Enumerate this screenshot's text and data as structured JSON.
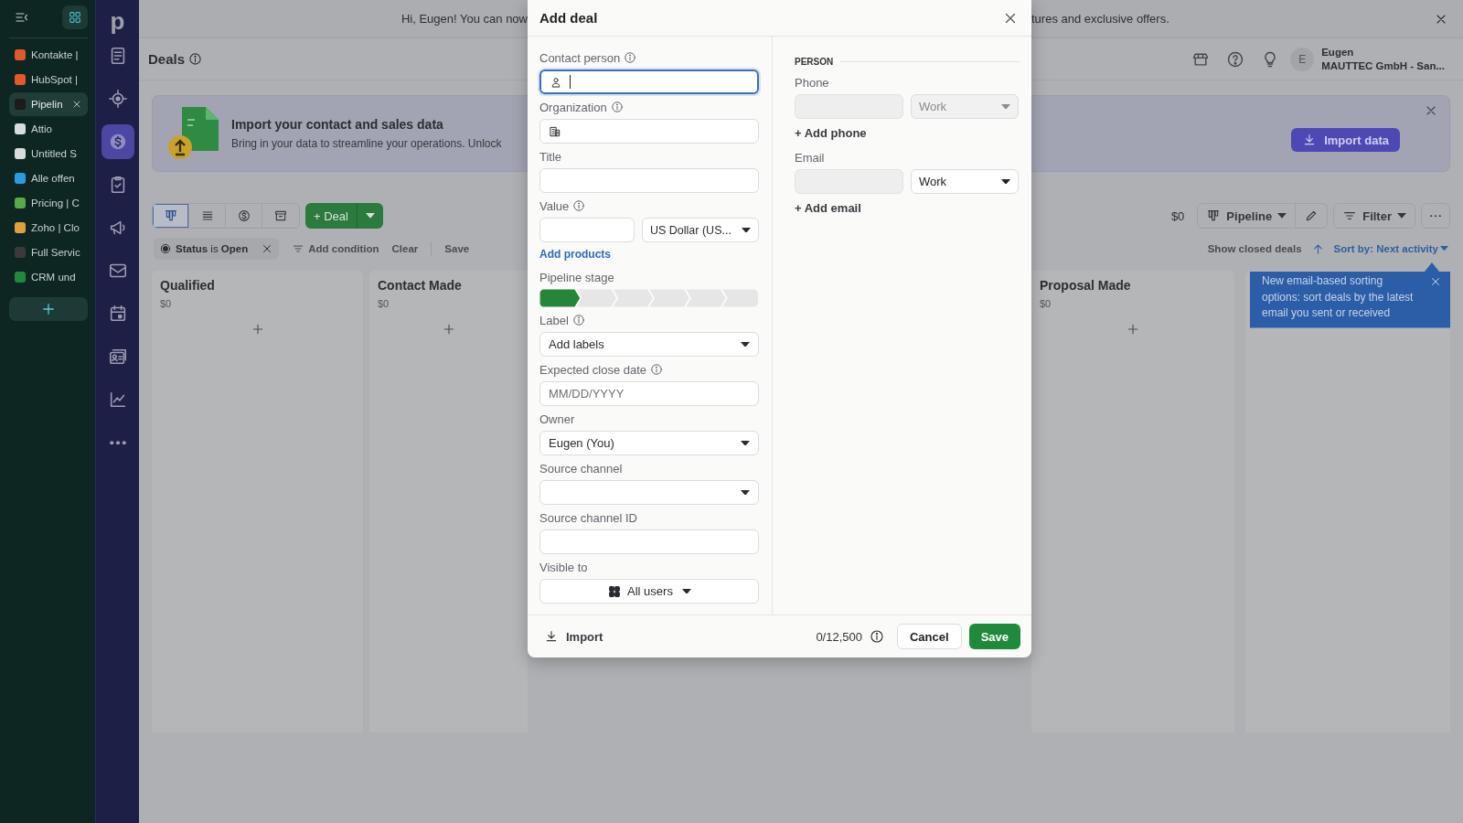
{
  "browser_sidebar": {
    "tabs": [
      {
        "label": "Kontakte |",
        "color": "#e0582c",
        "selected": false
      },
      {
        "label": "HubSpot |",
        "color": "#e8552a",
        "selected": false
      },
      {
        "label": "Pipelin",
        "color": "#1c1c1c",
        "selected": true
      },
      {
        "label": "Attio",
        "color": "#d8dcdc",
        "selected": false
      },
      {
        "label": "Untitled S",
        "color": "#d8dcdc",
        "selected": false
      },
      {
        "label": "Alle offen",
        "color": "#2a9be0",
        "selected": false
      },
      {
        "label": "Pricing | C",
        "color": "#5aa848",
        "selected": false
      },
      {
        "label": "Zoho | Clo",
        "color": "#e2a03a",
        "selected": false
      },
      {
        "label": "Full Servic",
        "color": "#3a3a3a",
        "selected": false
      },
      {
        "label": "CRM und",
        "color": "#1f8a3c",
        "selected": false
      }
    ]
  },
  "nav_rail": {
    "logo": "p",
    "items": [
      {
        "selected": false
      },
      {
        "selected": false
      },
      {
        "selected": true
      },
      {
        "selected": false
      },
      {
        "selected": false
      },
      {
        "selected": false
      },
      {
        "selected": false
      },
      {
        "selected": false
      },
      {
        "selected": false
      },
      {
        "selected": false
      }
    ]
  },
  "announcement": {
    "text_start": "Hi, Eugen! You can now",
    "text_end": "tures and exclusive offers."
  },
  "header": {
    "title": "Deals",
    "user": {
      "initial": "E",
      "name": "Eugen",
      "company": "MAUTTEC GmbH - San..."
    }
  },
  "import_banner": {
    "title": "Import your contact and sales data",
    "text": "Bring in your data to streamline your operations. Unlock",
    "button": "Import data"
  },
  "toolbar": {
    "views": [
      {
        "selected": true
      },
      {
        "selected": false
      },
      {
        "selected": false
      },
      {
        "selected": false
      }
    ],
    "add_button": "+ Deal",
    "total": "$0",
    "pipeline": "Pipeline",
    "filter": "Filter"
  },
  "filters": {
    "chip": "**Status** is **Open**",
    "add_condition": "Add condition",
    "clear": "Clear",
    "save": "Save",
    "show_closed": "Show closed deals",
    "sort": "Sort by: Next activity"
  },
  "columns": [
    {
      "title": "Qualified",
      "total": "$0"
    },
    {
      "title": "Contact Made",
      "total": "$0"
    },
    {
      "title": "Proposal Made",
      "total": "$0"
    }
  ],
  "tooltip": {
    "text": "New email-based sorting options: sort deals by the latest email you sent or received"
  },
  "modal": {
    "title": "Add deal",
    "fields": [
      {
        "kind": "contact",
        "label": "Contact person",
        "info": true,
        "focused": true
      },
      {
        "kind": "organization",
        "label": "Organization",
        "info": true,
        "focused": false
      },
      {
        "kind": "text",
        "label": "Title",
        "info": false,
        "focused": false
      },
      {
        "kind": "value",
        "label": "Value",
        "info": true,
        "focused": false,
        "currency": "US Dollar (US...",
        "link": "Add products"
      },
      {
        "kind": "stages",
        "label": "Pipeline stage",
        "info": false,
        "stages": [
          {
            "selected": true
          },
          {
            "selected": false
          },
          {
            "selected": false
          },
          {
            "selected": false
          },
          {
            "selected": false
          },
          {
            "selected": false
          }
        ]
      },
      {
        "kind": "select",
        "label": "Label",
        "info": true,
        "placeholder": "Add labels"
      },
      {
        "kind": "text",
        "label": "Expected close date",
        "info": true,
        "focused": false,
        "placeholder": "MM/DD/YYYY"
      },
      {
        "kind": "select",
        "label": "Owner",
        "info": false,
        "value": "Eugen (You)"
      },
      {
        "kind": "select",
        "label": "Source channel",
        "info": false
      },
      {
        "kind": "text",
        "label": "Source channel ID",
        "info": false,
        "focused": false
      },
      {
        "kind": "visibility",
        "label": "Visible to",
        "info": false,
        "value": "All users"
      }
    ],
    "person": {
      "section": "PERSON",
      "contacts": [
        {
          "label": "Phone",
          "type": "Work",
          "disabled": true,
          "add": "+ Add phone"
        },
        {
          "label": "Email",
          "type": "Work",
          "disabled": false,
          "add": "+ Add email"
        }
      ]
    },
    "footer": {
      "import": "Import",
      "counter": "0/12,500",
      "cancel": "Cancel",
      "save": "Save"
    }
  }
}
